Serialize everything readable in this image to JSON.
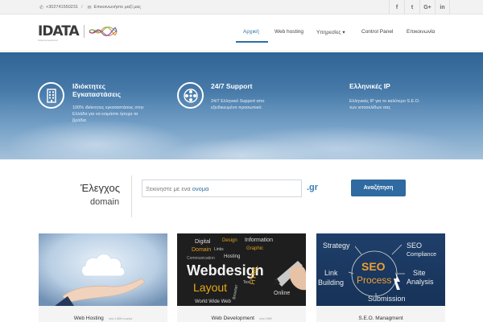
{
  "topbar": {
    "phone": "+302741550231",
    "contact_link": "Επικοινωνήστε μαζί μας",
    "social": [
      "f",
      "t",
      "G+",
      "in"
    ]
  },
  "logo": {
    "word": "IDATA",
    "tagline": "Internetsolution"
  },
  "nav": {
    "items": [
      {
        "label": "Αρχική",
        "active": true
      },
      {
        "label": "Web hosting"
      },
      {
        "label": "Υπηρεσίες ▾"
      },
      {
        "label": "Control Panel"
      },
      {
        "label": "Επικοινωνία"
      }
    ],
    "accent": "#2c6fa0"
  },
  "features": [
    {
      "icon": "building-icon",
      "title_line1": "Ιδιόκτητες",
      "title_line2": "Εγκαταστάσεις",
      "desc_line1": "100% ιδιόκτητες εγκαταστάσεις στην",
      "desc_line2": "Ελλάδα για να κοιμάστε ήσυχα τα",
      "desc_line3": "βράδια"
    },
    {
      "icon": "film-reel-icon",
      "title": "24/7 Support",
      "desc_line1": "24/7 Ελληνικό Support απο",
      "desc_line2": "εξειδικευμένο προσωπικό."
    },
    {
      "title": "Ελληνικές IP",
      "desc_line1": "Ελληνικές IP για το καλύτερο S.E.O.",
      "desc_line2": "των ιστοσελίδων σας"
    }
  ],
  "domain_check": {
    "label_line1": "Έλεγχος",
    "label_line2": "domain",
    "placeholder_prefix": "Ξεκινηστε με ενα",
    "placeholder_highlight": "ονομα",
    "tld": ".gr",
    "button": "Αναζήτηση"
  },
  "cards": [
    {
      "title": "Web Hosting",
      "subtitle": "απο 1,80€ το μήνα",
      "image": "cloud-hand-image"
    },
    {
      "title": "Web Development",
      "subtitle": "απο 199€",
      "image": "webdesign-words-image",
      "words": [
        "Digital",
        "Design",
        "Information",
        "Domain",
        "Links",
        "Graphic",
        "Hosting",
        "Communication",
        "Webdesign",
        "Layout",
        "HTML",
        "Browser",
        "Text",
        "Online",
        "World Wide Web"
      ]
    },
    {
      "title": "S.E.O. Managment",
      "subtitle": "",
      "image": "seo-chalkboard-image",
      "words": [
        "Strategy",
        "SEO",
        "Compliance",
        "Link",
        "Building",
        "SEO",
        "Process",
        "Site",
        "Analysis",
        "Submission"
      ]
    }
  ]
}
